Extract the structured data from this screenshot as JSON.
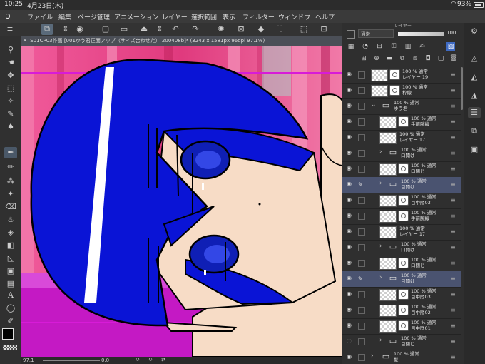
{
  "status": {
    "time": "10:25",
    "date": "4月23日(木)",
    "battery": "93%"
  },
  "menu": [
    "ファイル",
    "編集",
    "ページ管理",
    "アニメーション",
    "レイヤー",
    "選択範囲",
    "表示",
    "フィルター",
    "ウィンドウ",
    "ヘルプ"
  ],
  "document": {
    "tab_title": "S01CP03作画 [001ゆう君正面アップ（サイズ合わせた） 200408b]* (3243 x 1581px 96dpi 97.1%)"
  },
  "bottom": {
    "zoom": "97.1",
    "angle": "0.0"
  },
  "layer_panel": {
    "title": "レイヤー",
    "blend_mode": "通常",
    "opacity": "100",
    "layers": [
      {
        "l1": "100 %  通常",
        "l2": "レイヤー 19",
        "type": "raster",
        "mask": true
      },
      {
        "l1": "100 %  通常",
        "l2": "枠線",
        "type": "raster",
        "mask": true
      },
      {
        "l1": "100 %  通常",
        "l2": "ゆう君",
        "type": "folder_open"
      },
      {
        "l1": "100 %  通常",
        "l2": "手前腕線",
        "type": "raster",
        "mask": true
      },
      {
        "l1": "100 %  通常",
        "l2": "レイヤー 17",
        "type": "raster",
        "mask": false
      },
      {
        "l1": "100 %  通常",
        "l2": "口開け",
        "type": "folder"
      },
      {
        "l1": "100 %  通常",
        "l2": "口閉じ",
        "type": "raster",
        "mask": true
      },
      {
        "l1": "100 %  通常",
        "l2": "目開け",
        "type": "folder",
        "selected": true
      },
      {
        "l1": "100 %  通常",
        "l2": "目中間03",
        "type": "raster",
        "mask": true
      },
      {
        "l1": "100 %  通常",
        "l2": "手前腕線",
        "type": "raster",
        "mask": true
      },
      {
        "l1": "100 %  通常",
        "l2": "レイヤー 17",
        "type": "raster",
        "mask": false
      },
      {
        "l1": "100 %  通常",
        "l2": "口開け",
        "type": "folder"
      },
      {
        "l1": "100 %  通常",
        "l2": "口閉じ",
        "type": "raster",
        "mask": true
      },
      {
        "l1": "100 %  通常",
        "l2": "目開け",
        "type": "folder",
        "selected": true
      },
      {
        "l1": "100 %  通常",
        "l2": "目中間03",
        "type": "raster",
        "mask": true
      },
      {
        "l1": "100 %  通常",
        "l2": "目中間02",
        "type": "raster",
        "mask": true
      },
      {
        "l1": "100 %  通常",
        "l2": "目中間01",
        "type": "raster",
        "mask": true
      },
      {
        "l1": "100 %  通常",
        "l2": "目閉じ",
        "type": "folder"
      },
      {
        "l1": "100 %  通常",
        "l2": "髪",
        "type": "folder"
      }
    ]
  },
  "colors": {
    "accent": "#4a5370",
    "hair": "#0a14d6",
    "skin": "#f7dcc6",
    "floor": "#c419c4",
    "wall": "#e8458a"
  }
}
